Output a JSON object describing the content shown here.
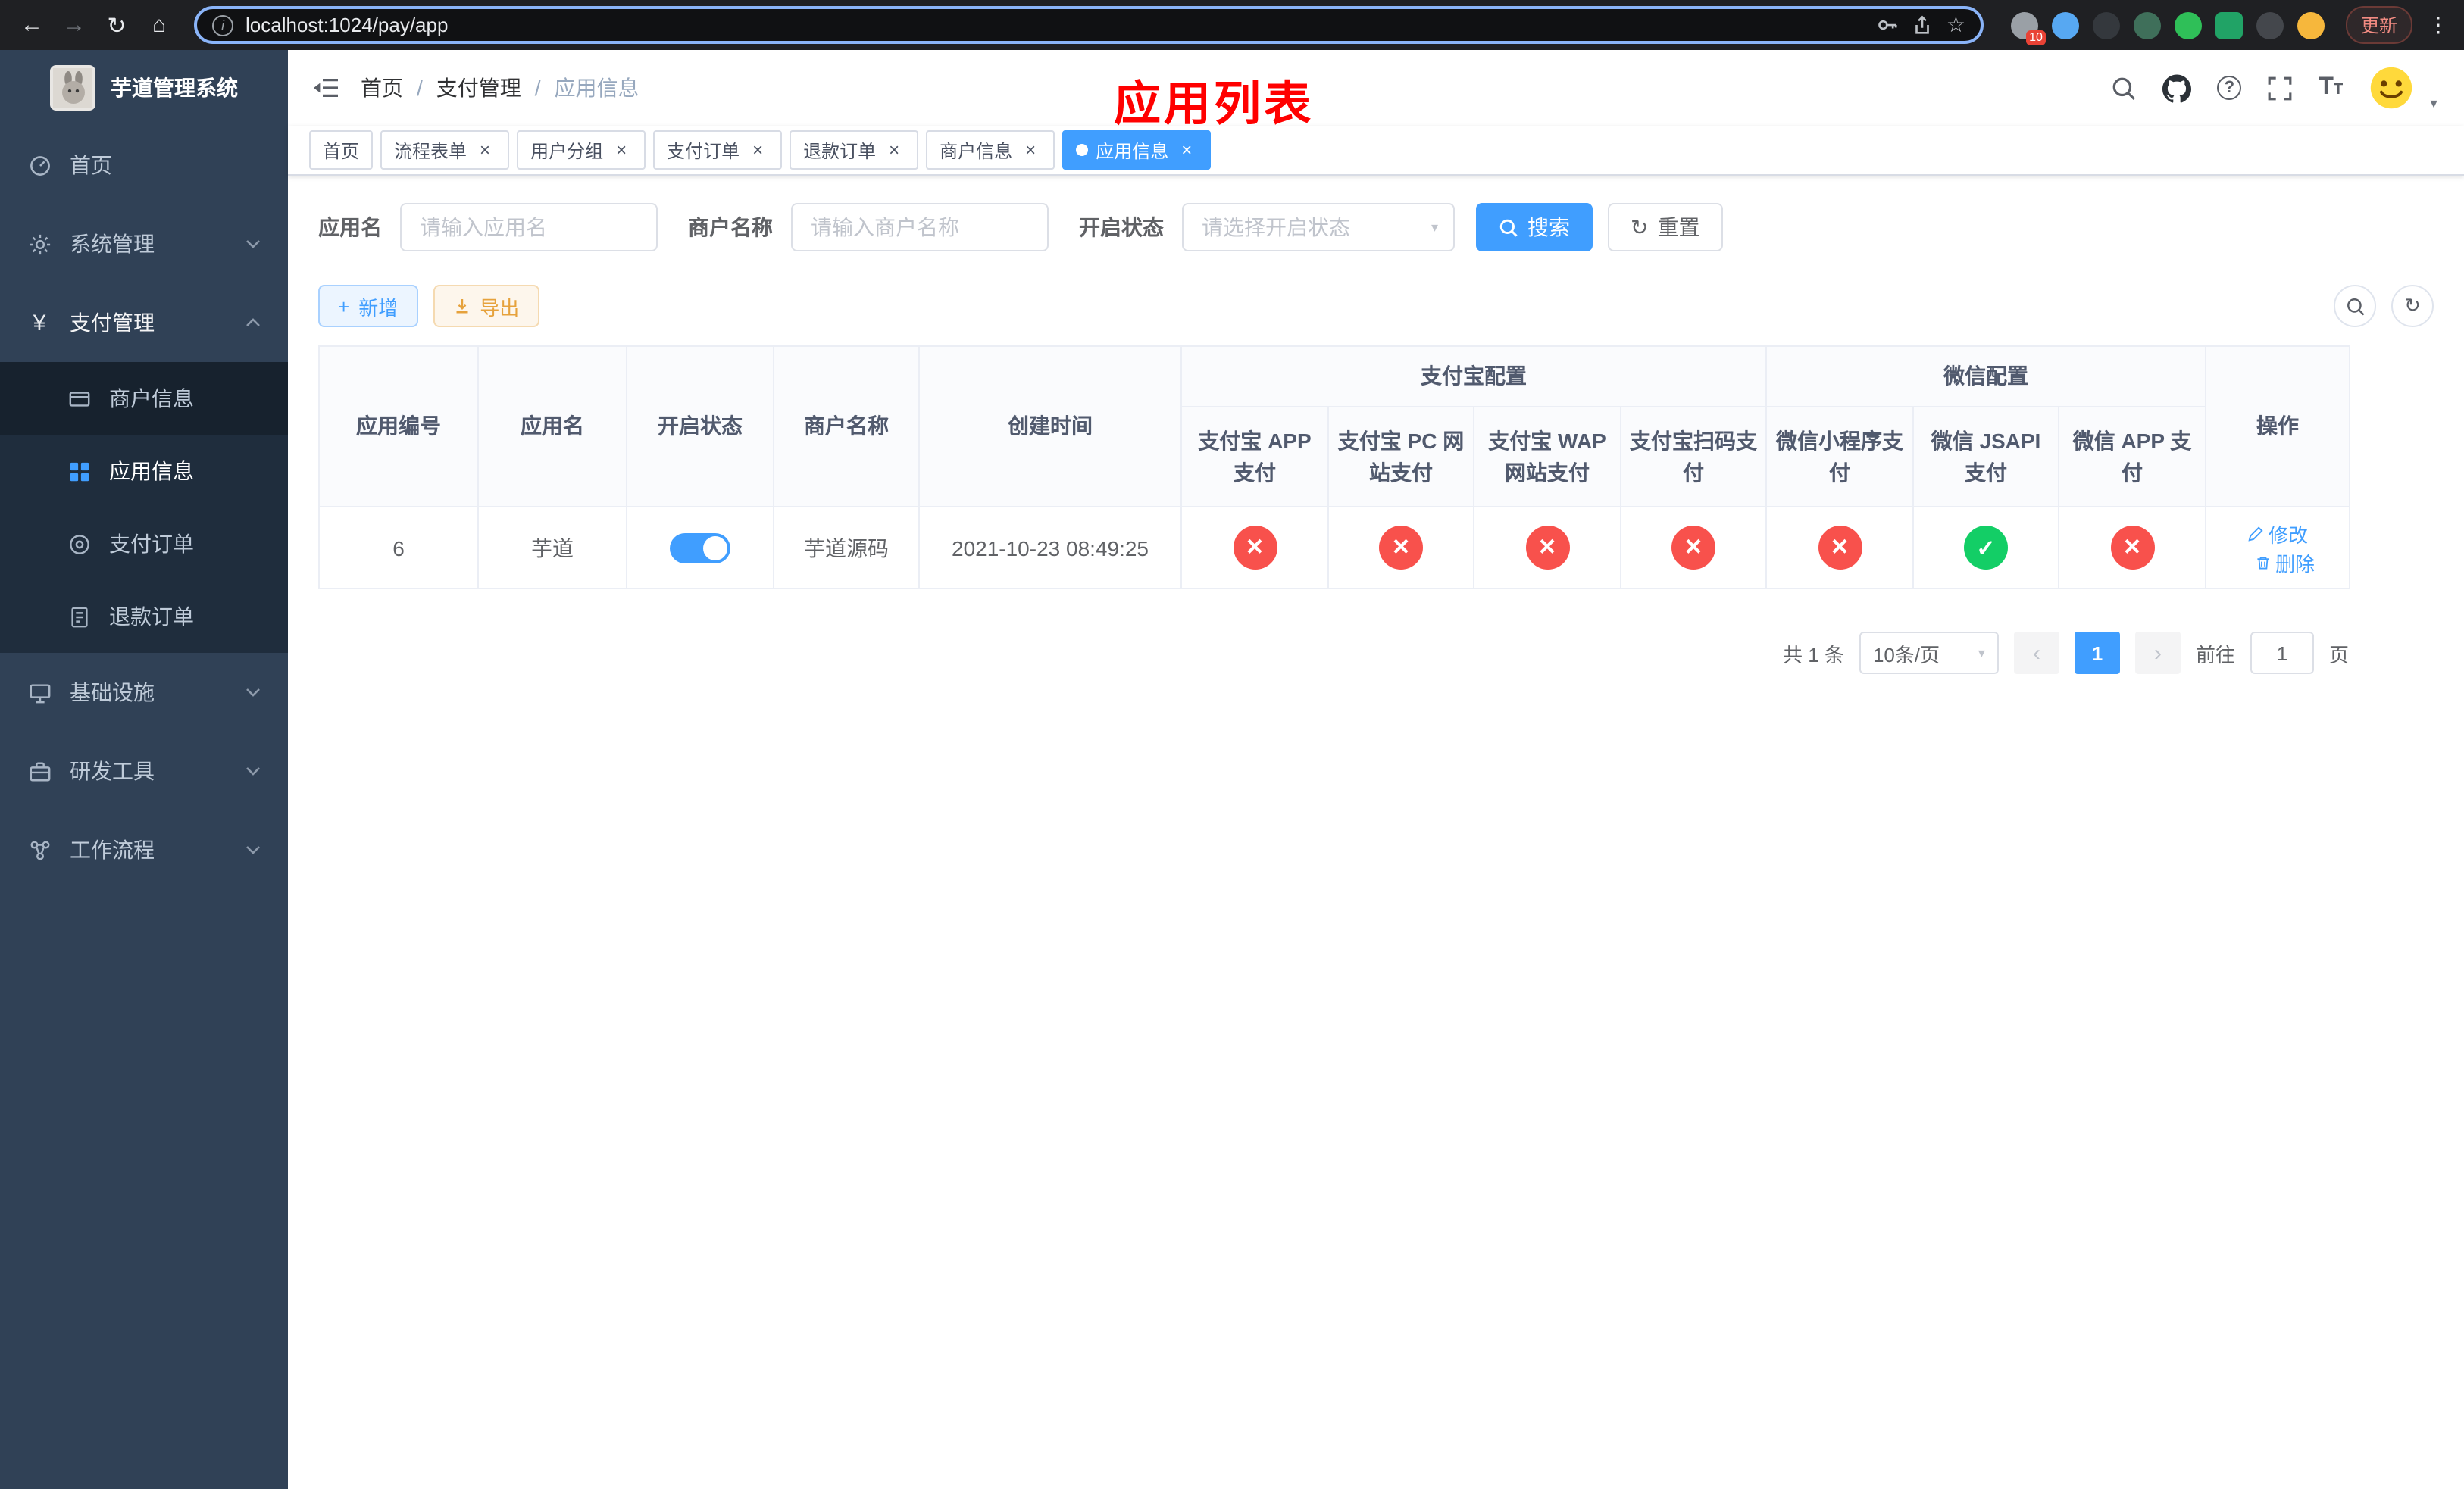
{
  "browser": {
    "url": "localhost:1024/pay/app",
    "update_label": "更新",
    "extension_badge": "10"
  },
  "sidebar": {
    "title": "芋道管理系统",
    "items": [
      {
        "label": "首页"
      },
      {
        "label": "系统管理"
      },
      {
        "label": "支付管理"
      },
      {
        "label": "基础设施"
      },
      {
        "label": "研发工具"
      },
      {
        "label": "工作流程"
      }
    ],
    "submenu": [
      {
        "label": "商户信息"
      },
      {
        "label": "应用信息"
      },
      {
        "label": "支付订单"
      },
      {
        "label": "退款订单"
      }
    ]
  },
  "navbar": {
    "breadcrumbs": [
      "首页",
      "支付管理",
      "应用信息"
    ],
    "separator": "/",
    "annotation": "应用列表"
  },
  "tabs": [
    {
      "label": "首页"
    },
    {
      "label": "流程表单"
    },
    {
      "label": "用户分组"
    },
    {
      "label": "支付订单"
    },
    {
      "label": "退款订单"
    },
    {
      "label": "商户信息"
    },
    {
      "label": "应用信息"
    }
  ],
  "filters": {
    "app_name_label": "应用名",
    "app_name_placeholder": "请输入应用名",
    "merchant_label": "商户名称",
    "merchant_placeholder": "请输入商户名称",
    "status_label": "开启状态",
    "status_placeholder": "请选择开启状态",
    "search_label": "搜索",
    "reset_label": "重置"
  },
  "toolbar": {
    "add_label": "新增",
    "export_label": "导出"
  },
  "table": {
    "headers": {
      "id": "应用编号",
      "name": "应用名",
      "status": "开启状态",
      "merchant": "商户名称",
      "created": "创建时间",
      "actions": "操作"
    },
    "groups": {
      "alipay": "支付宝配置",
      "wechat": "微信配置"
    },
    "sub_headers": [
      "支付宝 APP 支付",
      "支付宝 PC 网站支付",
      "支付宝 WAP 网站支付",
      "支付宝扫码支付",
      "微信小程序支付",
      "微信 JSAPI 支付",
      "微信 APP 支付"
    ],
    "row": {
      "id": "6",
      "name": "芋道",
      "enabled": true,
      "merchant": "芋道源码",
      "created": "2021-10-23 08:49:25",
      "statuses": [
        false,
        false,
        false,
        false,
        false,
        true,
        false
      ],
      "edit_label": "修改",
      "delete_label": "删除"
    }
  },
  "pagination": {
    "total": "共 1 条",
    "page_size": "10条/页",
    "current_page": "1",
    "goto_prefix": "前往",
    "goto_value": "1",
    "goto_suffix": "页"
  },
  "icons": {
    "back": "←",
    "forward": "→",
    "reload": "↻",
    "home": "⌂",
    "info": "i",
    "star": "☆",
    "kebab": "⋮",
    "close": "×",
    "caret_down": "▾",
    "user_caret": "▼",
    "plus": "+",
    "refresh": "↻",
    "question": "?",
    "font_large": "T",
    "font_small": "T",
    "yen": "¥",
    "check": "✓",
    "cross": "×",
    "prev": "‹",
    "next": "›"
  },
  "colors": {
    "primary": "#409eff",
    "danger": "#f8514c",
    "success": "#13ce66",
    "warning": "#e6a23c",
    "annotation": "#ff0000",
    "sidebar_bg": "#304156",
    "submenu_bg": "#1f2d3d"
  }
}
